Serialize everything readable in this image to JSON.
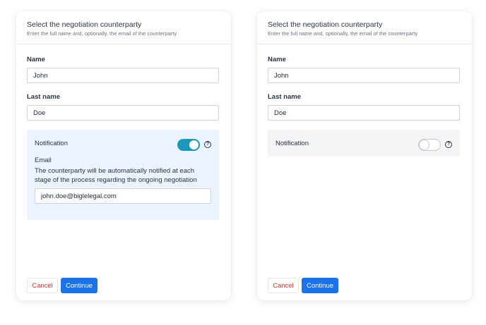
{
  "header": {
    "title": "Select the negotiation counterparty",
    "subtitle": "Enter the full name and, optionally, the email of the counterparty"
  },
  "form": {
    "name_label": "Name",
    "name_value": "John",
    "lastname_label": "Last name",
    "lastname_value": "Doe",
    "notification_label": "Notification",
    "help_glyph": "?"
  },
  "panel_on": {
    "toggle_state": "on",
    "email_label": "Email",
    "description": "The counterparty will be automatically notified at each stage of the process regarding the ongoing negotiation",
    "email_value": "john.doe@biglelegal.com"
  },
  "panel_off": {
    "toggle_state": "off"
  },
  "actions": {
    "cancel_label": "Cancel",
    "continue_label": "Continue"
  },
  "colors": {
    "accent": "#1a73e8",
    "toggle_on": "#1b97b8",
    "cancel_text": "#c0392b",
    "panel_on_bg": "#eaf3fe",
    "panel_off_bg": "#f3f4f6"
  },
  "icons": {
    "help": "help-circle-icon"
  }
}
